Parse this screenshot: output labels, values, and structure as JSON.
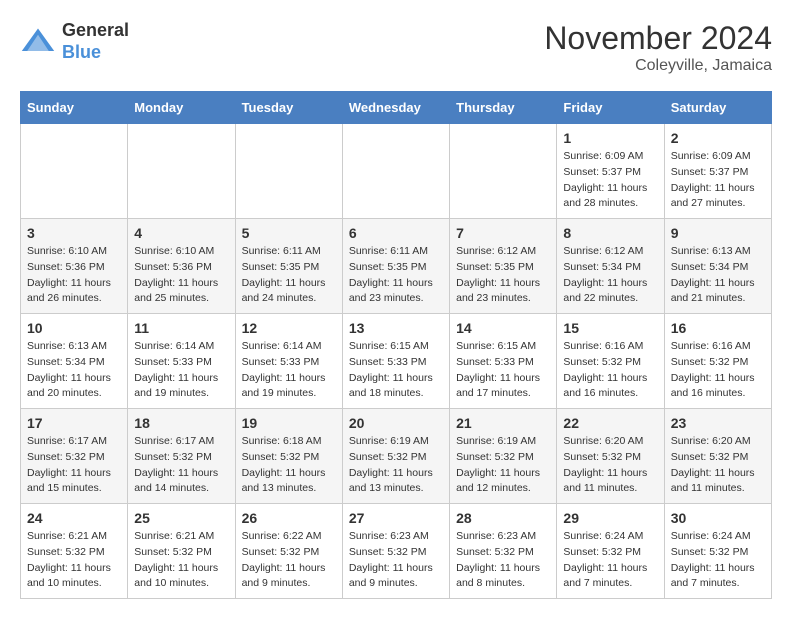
{
  "logo": {
    "general": "General",
    "blue": "Blue"
  },
  "header": {
    "month": "November 2024",
    "location": "Coleyville, Jamaica"
  },
  "weekdays": [
    "Sunday",
    "Monday",
    "Tuesday",
    "Wednesday",
    "Thursday",
    "Friday",
    "Saturday"
  ],
  "weeks": [
    [
      {
        "day": "",
        "info": ""
      },
      {
        "day": "",
        "info": ""
      },
      {
        "day": "",
        "info": ""
      },
      {
        "day": "",
        "info": ""
      },
      {
        "day": "",
        "info": ""
      },
      {
        "day": "1",
        "info": "Sunrise: 6:09 AM\nSunset: 5:37 PM\nDaylight: 11 hours\nand 28 minutes."
      },
      {
        "day": "2",
        "info": "Sunrise: 6:09 AM\nSunset: 5:37 PM\nDaylight: 11 hours\nand 27 minutes."
      }
    ],
    [
      {
        "day": "3",
        "info": "Sunrise: 6:10 AM\nSunset: 5:36 PM\nDaylight: 11 hours\nand 26 minutes."
      },
      {
        "day": "4",
        "info": "Sunrise: 6:10 AM\nSunset: 5:36 PM\nDaylight: 11 hours\nand 25 minutes."
      },
      {
        "day": "5",
        "info": "Sunrise: 6:11 AM\nSunset: 5:35 PM\nDaylight: 11 hours\nand 24 minutes."
      },
      {
        "day": "6",
        "info": "Sunrise: 6:11 AM\nSunset: 5:35 PM\nDaylight: 11 hours\nand 23 minutes."
      },
      {
        "day": "7",
        "info": "Sunrise: 6:12 AM\nSunset: 5:35 PM\nDaylight: 11 hours\nand 23 minutes."
      },
      {
        "day": "8",
        "info": "Sunrise: 6:12 AM\nSunset: 5:34 PM\nDaylight: 11 hours\nand 22 minutes."
      },
      {
        "day": "9",
        "info": "Sunrise: 6:13 AM\nSunset: 5:34 PM\nDaylight: 11 hours\nand 21 minutes."
      }
    ],
    [
      {
        "day": "10",
        "info": "Sunrise: 6:13 AM\nSunset: 5:34 PM\nDaylight: 11 hours\nand 20 minutes."
      },
      {
        "day": "11",
        "info": "Sunrise: 6:14 AM\nSunset: 5:33 PM\nDaylight: 11 hours\nand 19 minutes."
      },
      {
        "day": "12",
        "info": "Sunrise: 6:14 AM\nSunset: 5:33 PM\nDaylight: 11 hours\nand 19 minutes."
      },
      {
        "day": "13",
        "info": "Sunrise: 6:15 AM\nSunset: 5:33 PM\nDaylight: 11 hours\nand 18 minutes."
      },
      {
        "day": "14",
        "info": "Sunrise: 6:15 AM\nSunset: 5:33 PM\nDaylight: 11 hours\nand 17 minutes."
      },
      {
        "day": "15",
        "info": "Sunrise: 6:16 AM\nSunset: 5:32 PM\nDaylight: 11 hours\nand 16 minutes."
      },
      {
        "day": "16",
        "info": "Sunrise: 6:16 AM\nSunset: 5:32 PM\nDaylight: 11 hours\nand 16 minutes."
      }
    ],
    [
      {
        "day": "17",
        "info": "Sunrise: 6:17 AM\nSunset: 5:32 PM\nDaylight: 11 hours\nand 15 minutes."
      },
      {
        "day": "18",
        "info": "Sunrise: 6:17 AM\nSunset: 5:32 PM\nDaylight: 11 hours\nand 14 minutes."
      },
      {
        "day": "19",
        "info": "Sunrise: 6:18 AM\nSunset: 5:32 PM\nDaylight: 11 hours\nand 13 minutes."
      },
      {
        "day": "20",
        "info": "Sunrise: 6:19 AM\nSunset: 5:32 PM\nDaylight: 11 hours\nand 13 minutes."
      },
      {
        "day": "21",
        "info": "Sunrise: 6:19 AM\nSunset: 5:32 PM\nDaylight: 11 hours\nand 12 minutes."
      },
      {
        "day": "22",
        "info": "Sunrise: 6:20 AM\nSunset: 5:32 PM\nDaylight: 11 hours\nand 11 minutes."
      },
      {
        "day": "23",
        "info": "Sunrise: 6:20 AM\nSunset: 5:32 PM\nDaylight: 11 hours\nand 11 minutes."
      }
    ],
    [
      {
        "day": "24",
        "info": "Sunrise: 6:21 AM\nSunset: 5:32 PM\nDaylight: 11 hours\nand 10 minutes."
      },
      {
        "day": "25",
        "info": "Sunrise: 6:21 AM\nSunset: 5:32 PM\nDaylight: 11 hours\nand 10 minutes."
      },
      {
        "day": "26",
        "info": "Sunrise: 6:22 AM\nSunset: 5:32 PM\nDaylight: 11 hours\nand 9 minutes."
      },
      {
        "day": "27",
        "info": "Sunrise: 6:23 AM\nSunset: 5:32 PM\nDaylight: 11 hours\nand 9 minutes."
      },
      {
        "day": "28",
        "info": "Sunrise: 6:23 AM\nSunset: 5:32 PM\nDaylight: 11 hours\nand 8 minutes."
      },
      {
        "day": "29",
        "info": "Sunrise: 6:24 AM\nSunset: 5:32 PM\nDaylight: 11 hours\nand 7 minutes."
      },
      {
        "day": "30",
        "info": "Sunrise: 6:24 AM\nSunset: 5:32 PM\nDaylight: 11 hours\nand 7 minutes."
      }
    ]
  ]
}
